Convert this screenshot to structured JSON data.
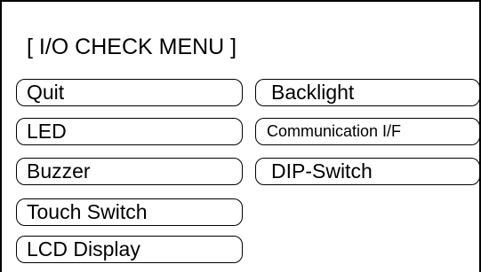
{
  "menu": {
    "title": "[ I/O CHECK MENU ]"
  },
  "buttons": {
    "left": [
      {
        "label": "Quit"
      },
      {
        "label": "LED"
      },
      {
        "label": "Buzzer"
      },
      {
        "label": "Touch Switch"
      },
      {
        "label": "LCD Display"
      }
    ],
    "right": [
      {
        "label": "Backlight"
      },
      {
        "label": "Communication I/F"
      },
      {
        "label": "DIP-Switch"
      }
    ]
  }
}
